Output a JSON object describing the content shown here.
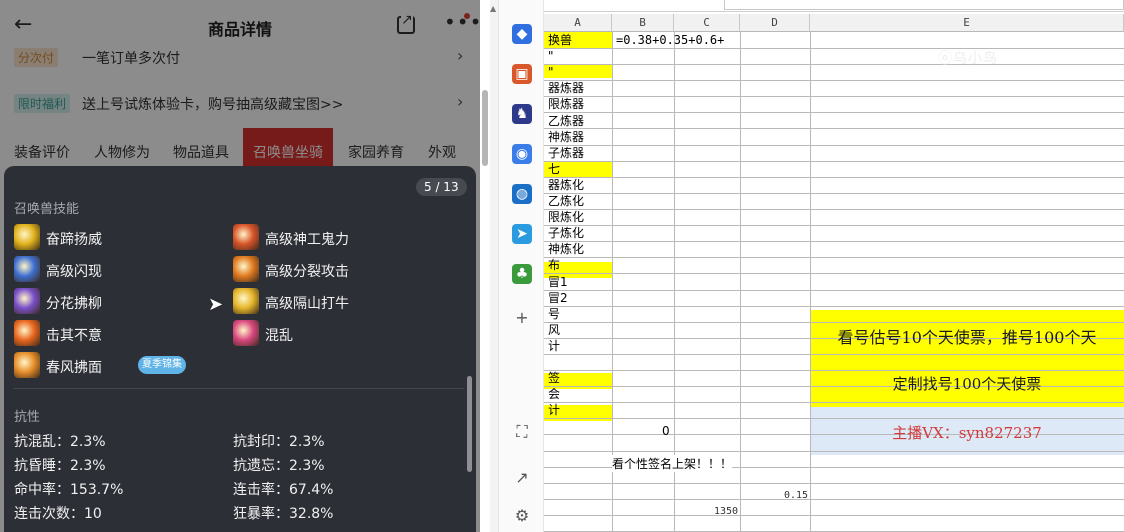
{
  "mobile": {
    "header": {
      "title": "商品详情"
    },
    "row_installment": {
      "tag": "分次付",
      "text": "一笔订单多次付"
    },
    "row_promo": {
      "tag": "限时福利",
      "text": "送上号试炼体验卡，购号抽高级藏宝图>>"
    },
    "tabs": [
      "装备评价",
      "人物修为",
      "物品道具",
      "召唤兽坐骑",
      "家园养育",
      "外观"
    ],
    "active_tab": "召唤兽坐骑",
    "popover": {
      "pager": "5 / 13",
      "skills_title": "召唤兽技能",
      "skills": [
        {
          "name": "奋蹄扬威",
          "icon": "hoof-skill-icon",
          "color": "#e0b21c"
        },
        {
          "name": "高级神工鬼力",
          "icon": "divine-force-skill-icon",
          "color": "#d9542a"
        },
        {
          "name": "高级闪现",
          "icon": "flash-skill-icon",
          "color": "#3f6fd0"
        },
        {
          "name": "高级分裂攻击",
          "icon": "split-attack-skill-icon",
          "color": "#e07a20"
        },
        {
          "name": "分花拂柳",
          "icon": "flower-skill-icon",
          "color": "#7a4fc9"
        },
        {
          "name": "高级隔山打牛",
          "icon": "mountain-strike-skill-icon",
          "color": "#e5b52a"
        },
        {
          "name": "击其不意",
          "icon": "surprise-strike-skill-icon",
          "color": "#e8661e"
        },
        {
          "name": "混乱",
          "icon": "chaos-skill-icon",
          "color": "#d9477f"
        },
        {
          "name": "春风拂面",
          "icon": "spring-breeze-skill-icon",
          "color": "#e88e2a"
        }
      ],
      "badge": "夏季锦集",
      "resist_title": "抗性",
      "stats": [
        "抗混乱：2.3%",
        "抗封印：2.3%",
        "抗昏睡：2.3%",
        "抗遗忘：2.3%",
        "命中率：153.7%",
        "连击率：67.4%",
        "连击次数：10",
        "狂暴率：32.8%"
      ]
    }
  },
  "sidebar_icons": [
    {
      "name": "tag-icon",
      "color": "#2f6fe0"
    },
    {
      "name": "briefcase-icon",
      "color": "#d9582b"
    },
    {
      "name": "chess-icon",
      "color": "#2d3a8a"
    },
    {
      "name": "copilot-icon",
      "color": "#3b7de8"
    },
    {
      "name": "outlook-icon",
      "color": "#1c6fc7"
    },
    {
      "name": "send-icon",
      "color": "#2b9be0"
    },
    {
      "name": "tree-icon",
      "color": "#3a9a3c"
    },
    {
      "name": "plus-icon",
      "color": "#555555"
    },
    {
      "name": "screenshot-icon",
      "color": "#555555"
    },
    {
      "name": "external-link-icon",
      "color": "#555555"
    },
    {
      "name": "gear-icon",
      "color": "#555555"
    }
  ],
  "sheet": {
    "col_headers": [
      "A",
      "B",
      "C",
      "D",
      "E"
    ],
    "cells": [
      "换兽",
      "\"",
      "\"",
      "器炼器",
      "限炼器",
      "乙炼器",
      "神炼器",
      "子炼器",
      "七",
      "器炼化",
      "乙炼化",
      "限炼化",
      "子炼化",
      "神炼化",
      "布",
      "冒1",
      "冒2",
      "号",
      "风",
      "计",
      "",
      "签",
      "会",
      "计",
      ""
    ],
    "formula": "=0.38+0.35+0.6+",
    "zero": "0",
    "note": "看个性签名上架！！！",
    "small_d": "0.15",
    "small_c": "1350",
    "e_row1": "看号估号10个天使票，推号100个天",
    "e_row2": "定制找号100个天使票",
    "e_row3": "主播VX：syn827237",
    "watermark": "ⓞ乌小鸟"
  }
}
